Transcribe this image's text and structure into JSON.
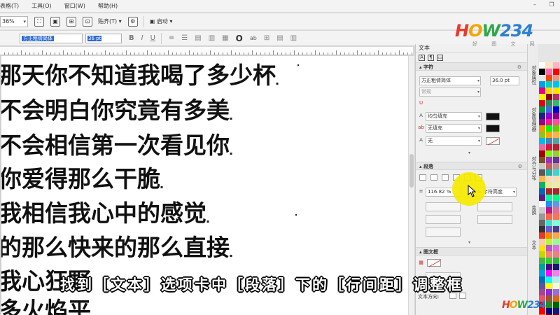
{
  "menubar": {
    "items": [
      "表格(T)",
      "工具(O)",
      "窗口(W)",
      "帮助(H)"
    ],
    "window_controls": [
      "–",
      "❐"
    ]
  },
  "toolbar": {
    "zoom": "36%",
    "paste_label": "贴齐(T)",
    "launch_label": "启动"
  },
  "propbar": {
    "font_name": "方正粗倩简体",
    "font_size": "36 pt",
    "format_buttons": [
      "B",
      "I",
      "U"
    ],
    "glyph_button": "ab"
  },
  "canvas": {
    "lines": [
      "那天你不知道我喝了多少杯",
      "不会明白你究竟有多美",
      "不会相信第一次看见你",
      "你爱得那么干脆",
      "我相信我心中的感觉",
      "的那么快来的那么直接",
      "我心狂野",
      "多火焰平"
    ]
  },
  "subtitle": "找到［文本］选项卡中［段落］下的［行间距］调整框",
  "logo": {
    "text": "HOW234",
    "sub": "好 图 文 网"
  },
  "docker": {
    "title": "文本",
    "character_section": {
      "title": "字符",
      "font": "方正粗倩简体",
      "size": "36.0 pt",
      "style": "常规",
      "fill": "均匀填充",
      "bg_fill": "无填充",
      "outline": "无"
    },
    "paragraph_section": {
      "title": "段落",
      "line_spacing": "116.82 %",
      "spacing_unit": "% 字符高度"
    },
    "frame_section": {
      "title": "图文框",
      "text_direction_label": "文本方向:"
    }
  },
  "side_tabs": [
    "对象属性",
    "对象管理器",
    "对齐与分布",
    "变换",
    "文本"
  ],
  "colors": {
    "logo_h": "#e83a2f",
    "logo_o": "#f7a400",
    "logo_w": "#2da84a",
    "logo_digits": "#2c7fd1",
    "highlight": "#f5ea00",
    "selection": "#2d6bd1"
  },
  "icons": [
    "paste-icon",
    "launch-icon",
    "gear-icon",
    "cursor-arrow-icon",
    "color-swatch-icon"
  ]
}
